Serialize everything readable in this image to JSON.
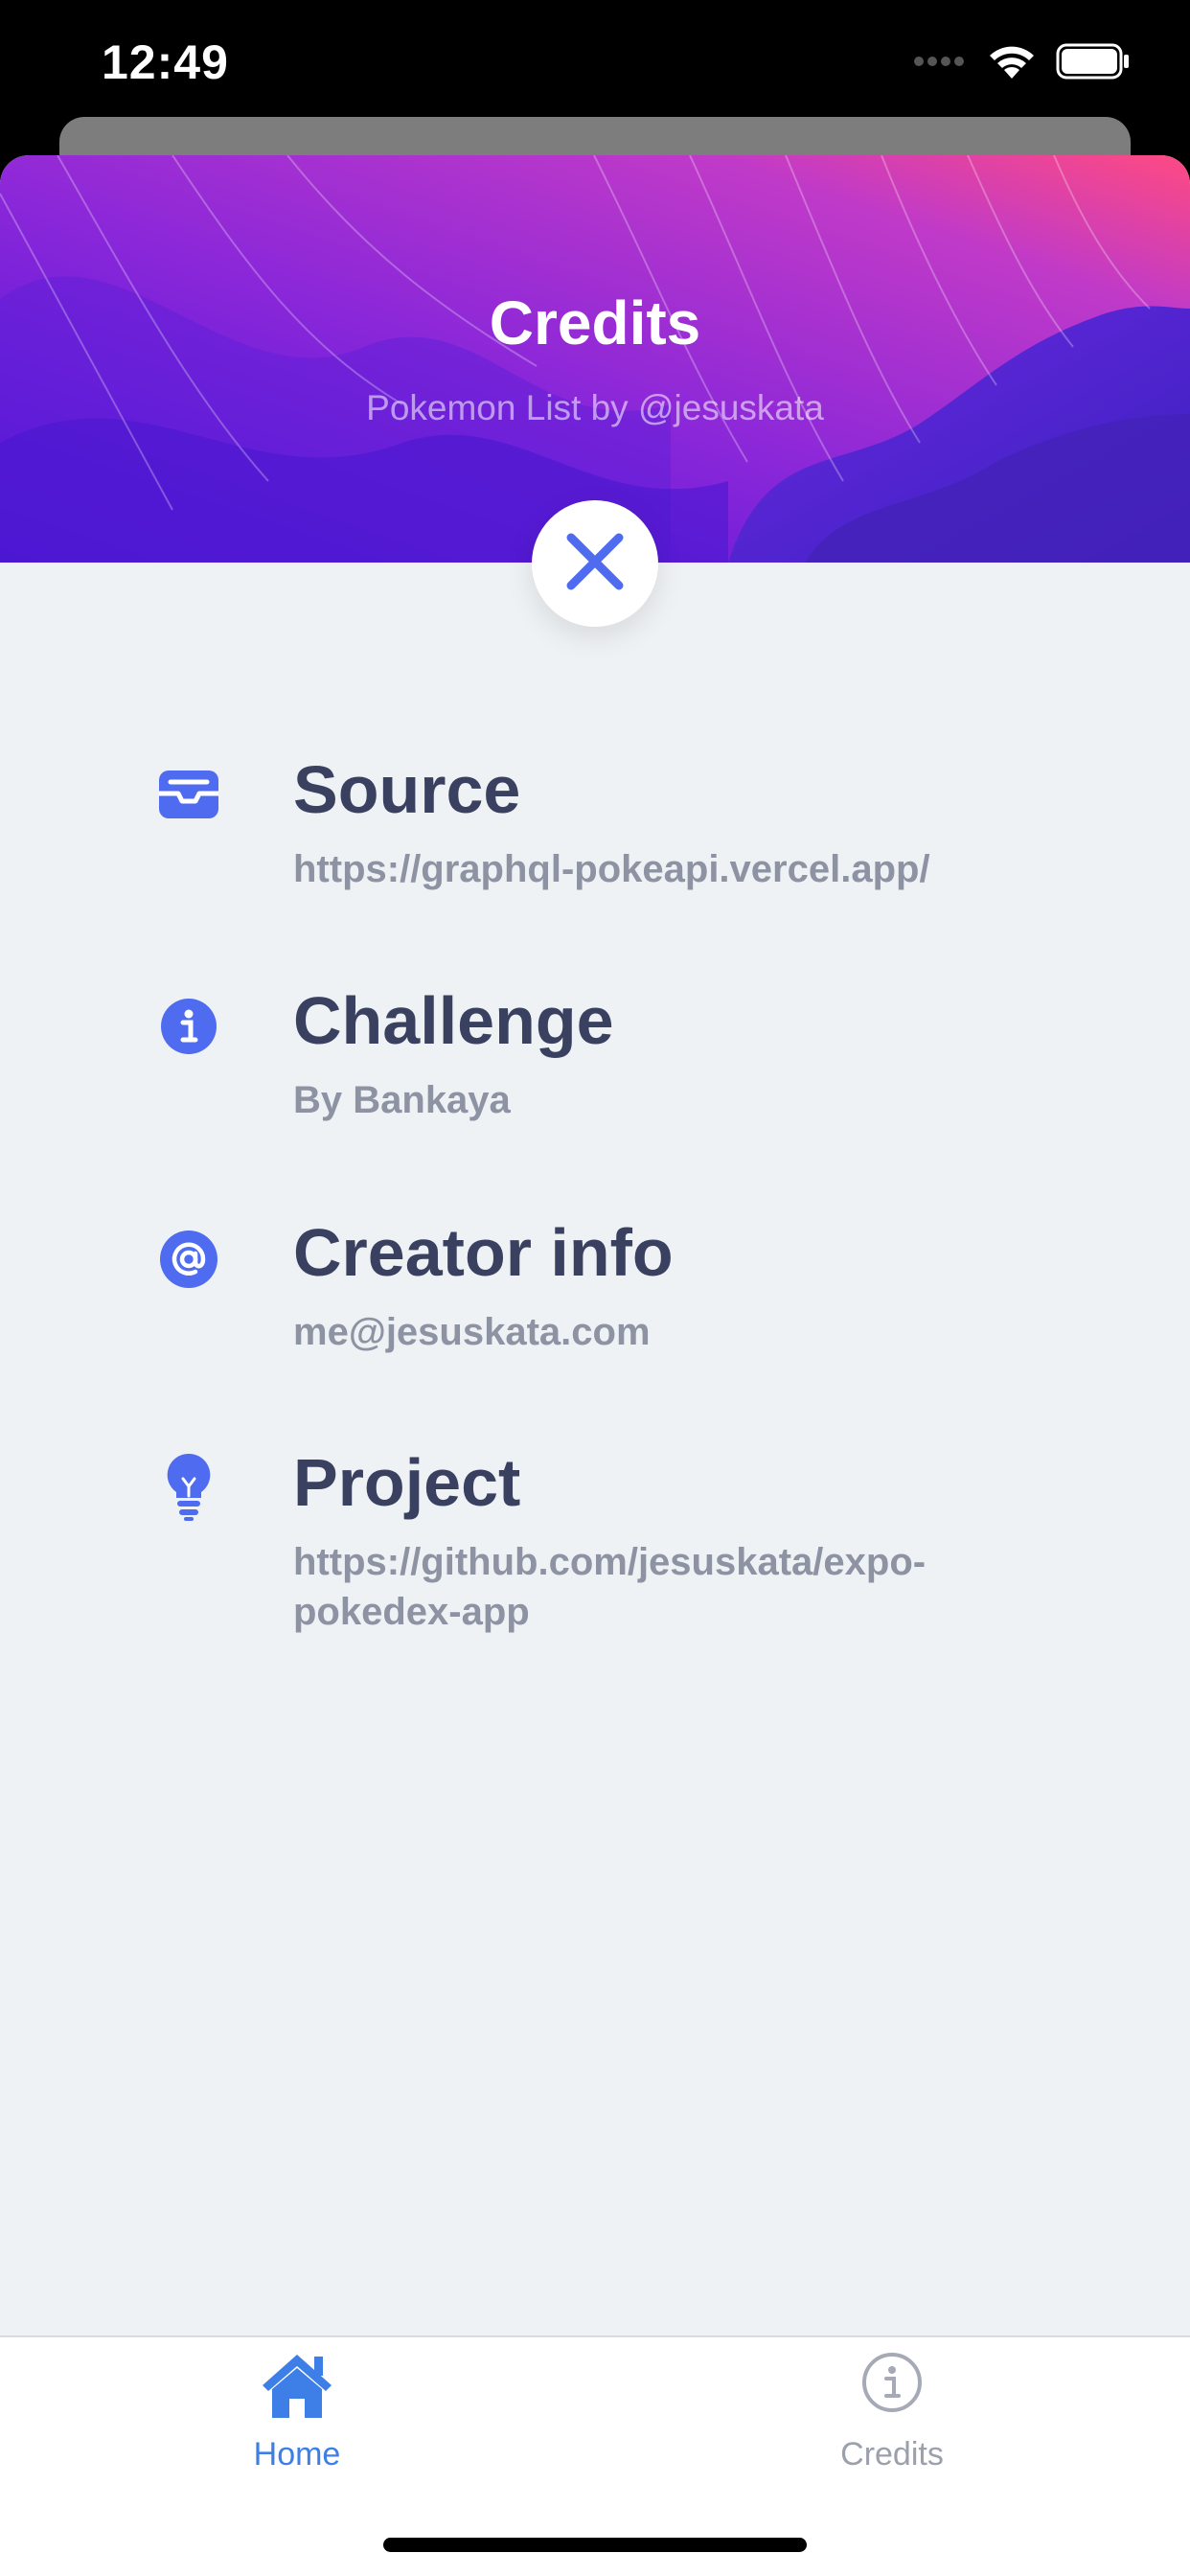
{
  "status_bar": {
    "time": "12:49",
    "icons": [
      "signal-icon",
      "wifi-icon",
      "battery-icon"
    ]
  },
  "header": {
    "title": "Credits",
    "subtitle": "Pokemon List by @jesuskata",
    "close_icon": "close-icon"
  },
  "items": [
    {
      "icon": "inbox-icon",
      "title": "Source",
      "value": "https://graphql-pokeapi.vercel.app/"
    },
    {
      "icon": "info-icon",
      "title": "Challenge",
      "value": "By Bankaya"
    },
    {
      "icon": "at-sign-icon",
      "title": "Creator info",
      "value": "me@jesuskata.com"
    },
    {
      "icon": "lightbulb-icon",
      "title": "Project",
      "value": "https://github.com/jesuskata/expo-pokedex-app"
    }
  ],
  "tab_bar": {
    "tabs": [
      {
        "label": "Home",
        "icon": "home-icon",
        "active": true
      },
      {
        "label": "Credits",
        "icon": "info-circle-icon",
        "active": false
      }
    ]
  },
  "colors": {
    "accent": "#4f6cf0",
    "active_tab": "#3d7fe6",
    "inactive_tab": "#9ba0ad",
    "title_text": "#3a4160",
    "value_text": "#8e93a3",
    "sheet_bg": "#eff2f5"
  }
}
